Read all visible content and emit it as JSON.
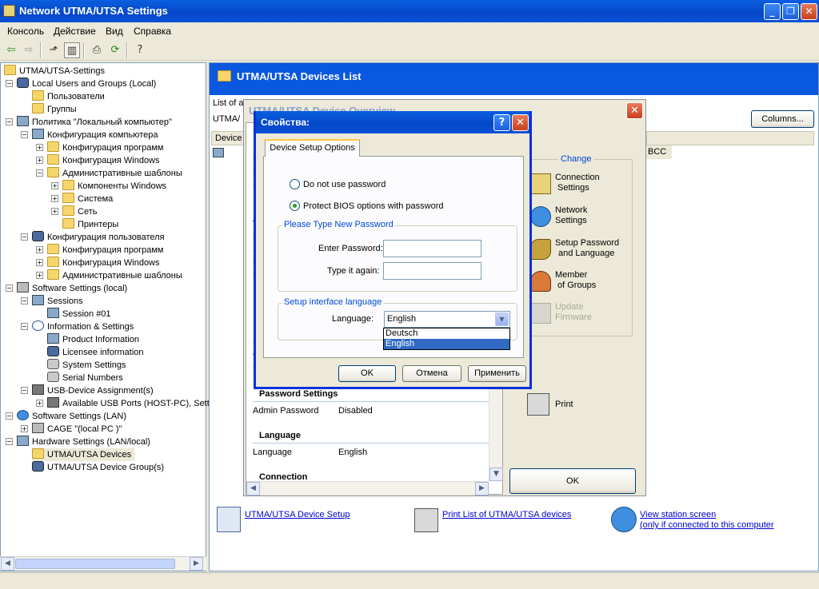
{
  "window": {
    "title": "Network UTMA/UTSA Settings"
  },
  "menu": [
    "Консоль",
    "Действие",
    "Вид",
    "Справка"
  ],
  "tree": [
    {
      "label": "UTMA/UTSA-Settings"
    },
    {
      "label": "Local Users and Groups (Local)"
    },
    {
      "label": "Пользователи"
    },
    {
      "label": "Группы"
    },
    {
      "label": "Политика \"Локальный компьютер\""
    },
    {
      "label": "Конфигурация компьютера"
    },
    {
      "label": "Конфигурация программ"
    },
    {
      "label": "Конфигурация Windows"
    },
    {
      "label": "Административные шаблоны"
    },
    {
      "label": "Компоненты Windows"
    },
    {
      "label": "Система"
    },
    {
      "label": "Сеть"
    },
    {
      "label": "Принтеры"
    },
    {
      "label": "Конфигурация пользователя"
    },
    {
      "label": "Конфигурация программ"
    },
    {
      "label": "Конфигурация Windows"
    },
    {
      "label": "Административные шаблоны"
    },
    {
      "label": "Software Settings (local)"
    },
    {
      "label": "Sessions"
    },
    {
      "label": "Session #01"
    },
    {
      "label": "Information & Settings"
    },
    {
      "label": "Product Information"
    },
    {
      "label": "Licensee information"
    },
    {
      "label": "System Settings"
    },
    {
      "label": "Serial Numbers"
    },
    {
      "label": "USB-Device Assignment(s)"
    },
    {
      "label": "Available USB Ports (HOST-PC), Sett"
    },
    {
      "label": "Software Settings (LAN)"
    },
    {
      "label": "CAGE \"(local PC )\""
    },
    {
      "label": "Hardware Settings (LAN/local)"
    },
    {
      "label": "UTMA/UTSA Devices"
    },
    {
      "label": "UTMA/UTSA Device Group(s)"
    }
  ],
  "right": {
    "header": "UTMA/UTSA Devices List",
    "list_of_prefix": "List of a",
    "utma_prefix": "UTMA/",
    "device_col": "Device",
    "columns_button": "Columns...",
    "bcc_fragment": "BCC",
    "links": {
      "setup": "UTMA/UTSA Device Setup",
      "print": "Print List of UTMA/UTSA devices",
      "view1": "View station screen",
      "view2": "(only if connected to this computer"
    }
  },
  "overview": {
    "title": "UTMA/UTSA Device Overview",
    "left_fragments": [
      "D",
      "D",
      "S",
      "V",
      "B",
      "S",
      "D",
      "B",
      "IF",
      "IF",
      "S",
      "G",
      "M"
    ],
    "password_settings": "Password Settings",
    "admin_password_label": "Admin Password",
    "admin_password_value": "Disabled",
    "language_heading": "Language",
    "language_label": "Language",
    "language_value": "English",
    "connection_heading": "Connection",
    "change_title": "Change",
    "actions": [
      {
        "line1": "Connection",
        "line2": "Settings",
        "icon": "connection-icon",
        "disabled": false
      },
      {
        "line1": "Network",
        "line2": "Settings",
        "icon": "network-globe-icon",
        "disabled": false
      },
      {
        "line1": "Setup Password",
        "line2": "and Language",
        "icon": "keys-icon",
        "disabled": false
      },
      {
        "line1": "Member",
        "line2": "of Groups",
        "icon": "group-icon",
        "disabled": false
      },
      {
        "line1": "Update",
        "line2": "Firmware",
        "icon": "firmware-chip-icon",
        "disabled": true
      }
    ],
    "print_label": "Print",
    "ok_label": "OK"
  },
  "props": {
    "title": "Свойства:",
    "help_glyph": "?",
    "close_glyph": "✕",
    "tab": "Device Setup Options",
    "radio_no_password": "Do not use  password",
    "radio_protect": "Protect BIOS options with password",
    "group_password": "Please Type New Password",
    "enter_password": "Enter Password:",
    "type_again": "Type it again:",
    "group_language": "Setup interface language",
    "language_label": "Language:",
    "language_value": "English",
    "language_options": [
      "Deutsch",
      "English"
    ],
    "ok": "OK",
    "cancel": "Отмена",
    "apply": "Применить"
  }
}
